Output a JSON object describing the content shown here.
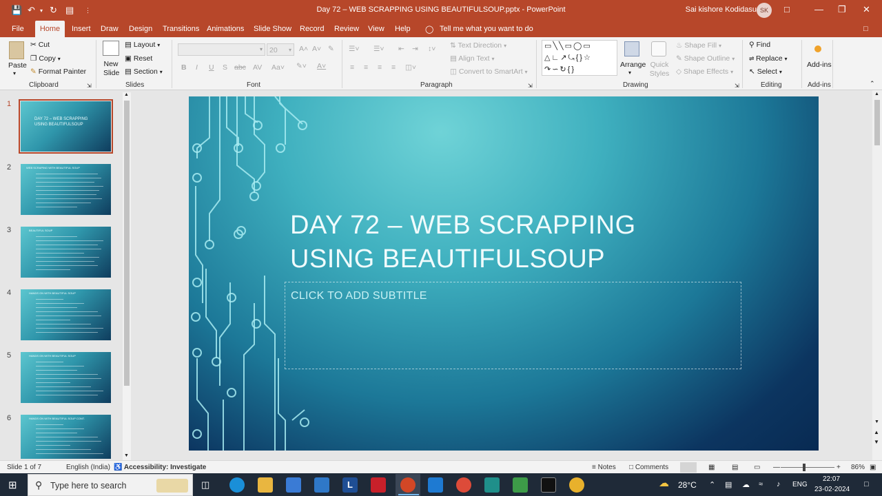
{
  "titlebar": {
    "title": "Day 72 – WEB SCRAPPING USING BEAUTIFULSOUP.pptx  -  PowerPoint",
    "user": "Sai kishore Kodidasu",
    "avatar_initials": "SK"
  },
  "tabs": [
    "File",
    "Home",
    "Insert",
    "Draw",
    "Design",
    "Transitions",
    "Animations",
    "Slide Show",
    "Record",
    "Review",
    "View",
    "Help"
  ],
  "tell_me": "Tell me what you want to do",
  "ribbon": {
    "clipboard": {
      "label": "Clipboard",
      "paste": "Paste",
      "cut": "Cut",
      "copy": "Copy",
      "format_painter": "Format Painter"
    },
    "slides": {
      "label": "Slides",
      "new_slide": "New Slide",
      "layout": "Layout",
      "reset": "Reset",
      "section": "Section"
    },
    "font": {
      "label": "Font",
      "size": "20"
    },
    "paragraph": {
      "label": "Paragraph",
      "text_direction": "Text Direction",
      "align_text": "Align Text",
      "convert": "Convert to SmartArt"
    },
    "drawing": {
      "label": "Drawing",
      "arrange": "Arrange",
      "quick_styles": "Quick Styles",
      "shape_fill": "Shape Fill",
      "shape_outline": "Shape Outline",
      "shape_effects": "Shape Effects"
    },
    "editing": {
      "label": "Editing",
      "find": "Find",
      "replace": "Replace",
      "select": "Select"
    },
    "addins": {
      "label": "Add-ins",
      "button": "Add-ins"
    }
  },
  "thumbnails": [
    {
      "num": "1",
      "title": "DAY 72 – WEB SCRAPPING USING BEAUTIFULSOUP"
    },
    {
      "num": "2",
      "title": "WEB SCRAPING WITH BEAUTIFUL SOUP"
    },
    {
      "num": "3",
      "title": "BEAUTIFUL SOUP"
    },
    {
      "num": "4",
      "title": "HANDS ON WITH BEAUTIFUL SOUP"
    },
    {
      "num": "5",
      "title": "HANDS ON WITH BEAUTIFUL SOUP"
    },
    {
      "num": "6",
      "title": "HANDS ON WITH BEAUTIFUL SOUP CONT."
    }
  ],
  "slide": {
    "title_line1": "DAY 72 – WEB SCRAPPING",
    "title_line2": "USING BEAUTIFULSOUP",
    "subtitle_placeholder": "CLICK TO ADD SUBTITLE"
  },
  "statusbar": {
    "slide_count": "Slide 1 of 7",
    "language": "English (India)",
    "accessibility": "Accessibility: Investigate",
    "notes": "Notes",
    "comments": "Comments",
    "zoom": "86%"
  },
  "taskbar": {
    "search_placeholder": "Type here to search",
    "temperature": "28°C",
    "lang": "ENG",
    "time": "22:07",
    "date": "23-02-2024"
  }
}
